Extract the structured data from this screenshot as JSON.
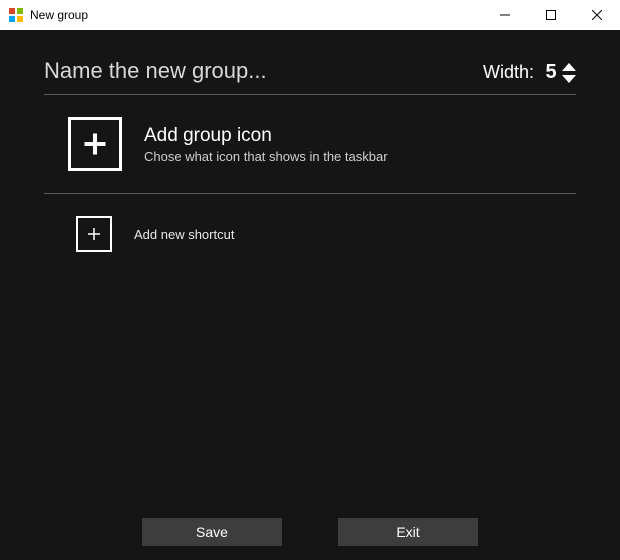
{
  "window": {
    "title": "New group"
  },
  "header": {
    "name_placeholder": "Name the new group...",
    "name_value": "",
    "width_label": "Width:",
    "width_value": "5"
  },
  "group_icon": {
    "title": "Add group icon",
    "subtitle": "Chose what icon that shows in the taskbar"
  },
  "shortcut": {
    "label": "Add new shortcut"
  },
  "footer": {
    "save_label": "Save",
    "exit_label": "Exit"
  }
}
